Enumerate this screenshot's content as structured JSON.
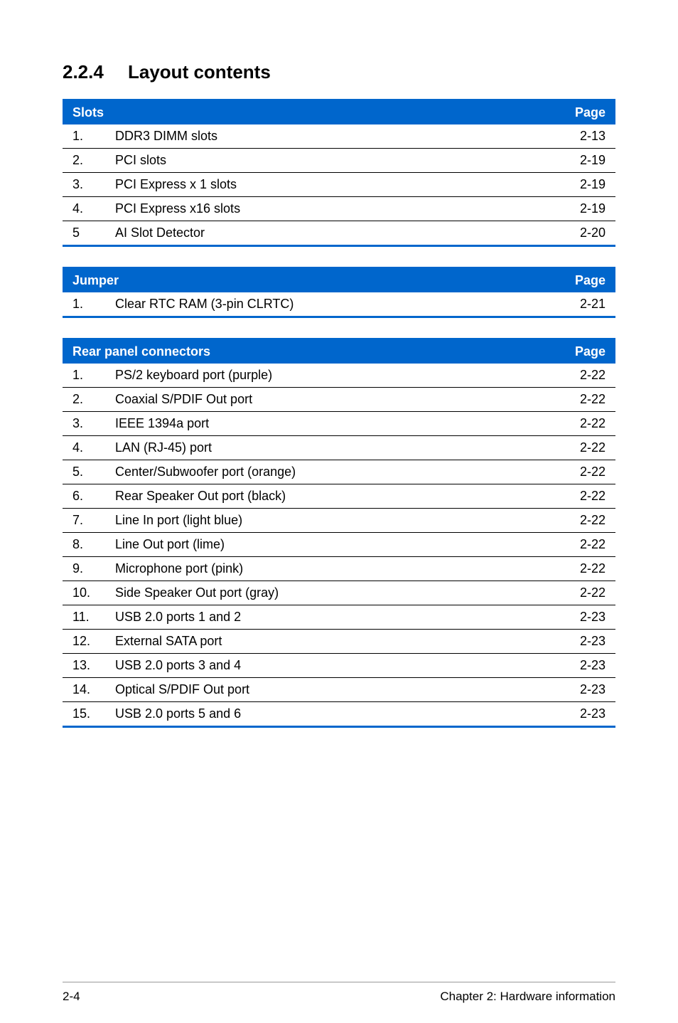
{
  "heading": {
    "number": "2.2.4",
    "title": "Layout contents"
  },
  "tables": [
    {
      "header": {
        "label": "Slots",
        "page": "Page"
      },
      "rows": [
        {
          "idx": "1.",
          "label": "DDR3 DIMM slots",
          "page": "2-13"
        },
        {
          "idx": "2.",
          "label": "PCI slots",
          "page": "2-19"
        },
        {
          "idx": "3.",
          "label": "PCI Express x 1 slots",
          "page": "2-19"
        },
        {
          "idx": "4.",
          "label": "PCI Express x16 slots",
          "page": "2-19"
        },
        {
          "idx": "5",
          "label": "AI Slot Detector",
          "page": "2-20"
        }
      ]
    },
    {
      "header": {
        "label": "Jumper",
        "page": "Page"
      },
      "rows": [
        {
          "idx": "1.",
          "label": "Clear RTC RAM (3-pin CLRTC)",
          "page": "2-21"
        }
      ]
    },
    {
      "header": {
        "label": "Rear panel connectors",
        "page": "Page"
      },
      "rows": [
        {
          "idx": "1.",
          "label": "PS/2 keyboard port (purple)",
          "page": "2-22"
        },
        {
          "idx": "2.",
          "label": "Coaxial S/PDIF Out port",
          "page": "2-22"
        },
        {
          "idx": "3.",
          "label": "IEEE 1394a port",
          "page": "2-22"
        },
        {
          "idx": "4.",
          "label": "LAN (RJ-45) port",
          "page": "2-22"
        },
        {
          "idx": "5.",
          "label": "Center/Subwoofer port (orange)",
          "page": "2-22"
        },
        {
          "idx": "6.",
          "label": "Rear Speaker Out port (black)",
          "page": "2-22"
        },
        {
          "idx": "7.",
          "label": "Line In port (light blue)",
          "page": "2-22"
        },
        {
          "idx": "8.",
          "label": "Line Out port (lime)",
          "page": "2-22"
        },
        {
          "idx": "9.",
          "label": "Microphone port (pink)",
          "page": "2-22"
        },
        {
          "idx": "10.",
          "label": "Side Speaker Out port (gray)",
          "page": "2-22"
        },
        {
          "idx": "11.",
          "label": "USB 2.0 ports 1 and 2",
          "page": "2-23"
        },
        {
          "idx": "12.",
          "label": "External SATA port",
          "page": "2-23"
        },
        {
          "idx": "13.",
          "label": "USB 2.0 ports 3 and 4",
          "page": "2-23"
        },
        {
          "idx": "14.",
          "label": "Optical S/PDIF Out port",
          "page": "2-23"
        },
        {
          "idx": "15.",
          "label": "USB 2.0 ports 5 and 6",
          "page": "2-23"
        }
      ]
    }
  ],
  "footer": {
    "left": "2-4",
    "right": "Chapter 2: Hardware information"
  }
}
